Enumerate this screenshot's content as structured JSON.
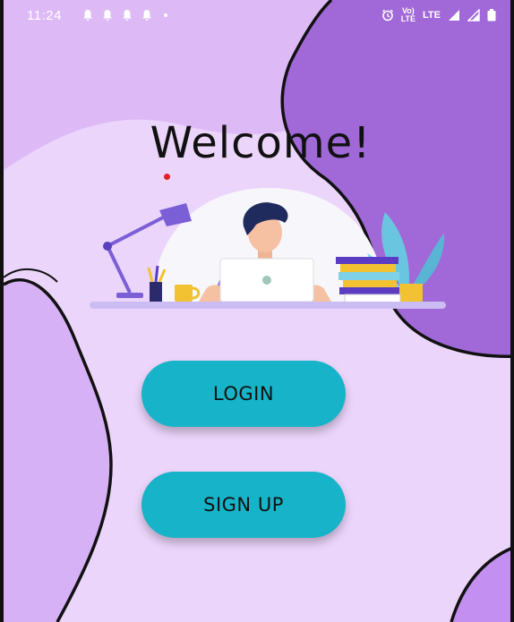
{
  "status_bar": {
    "time": "11:24",
    "notification_icons": [
      "bell-icon",
      "bell-icon",
      "bell-icon",
      "bell-icon"
    ],
    "network_label_top": "Vo)",
    "network_label_bottom": "LTE",
    "lte_label": "LTE",
    "right_icons": [
      "alarm-icon",
      "signal-icon",
      "signal-icon",
      "battery-icon"
    ]
  },
  "screen": {
    "title": "Welcome!",
    "login_label": "LOGIN",
    "signup_label": "SIGN UP"
  },
  "colors": {
    "background": "#ecd5fb",
    "blob_dark": "#a168d8",
    "blob_light": "#d7b1f5",
    "button": "#17b3c8",
    "title": "#111111"
  }
}
